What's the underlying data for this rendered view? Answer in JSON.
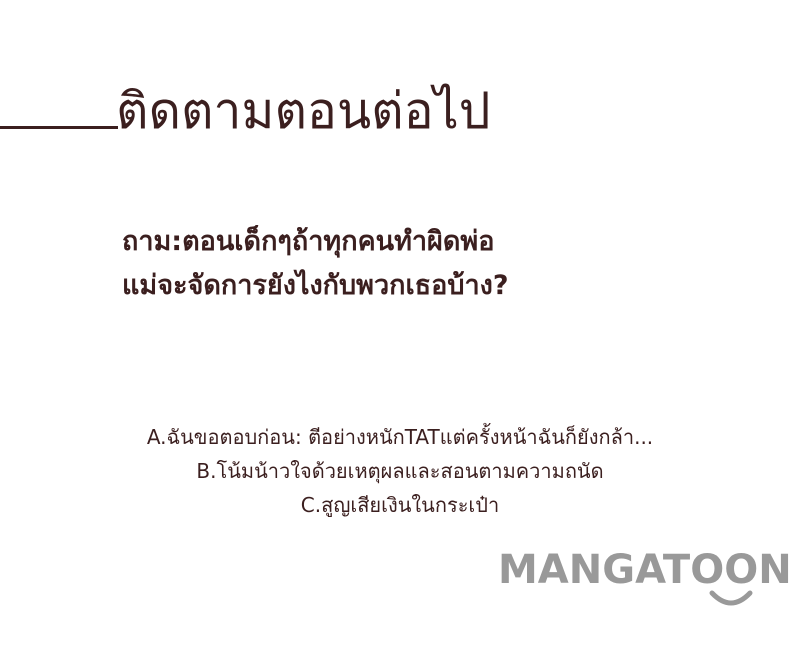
{
  "heading": "ติดตามตอนต่อไป",
  "question": {
    "line1": "ถาม:ตอนเด็กๆถ้าทุกคนทำผิดพ่อ",
    "line2": "แม่จะจัดการยังไงกับพวกเธอบ้าง?"
  },
  "options": [
    "A.ฉันขอตอบก่อน: ตีอย่างหนักTATแต่ครั้งหน้าฉันก็ยังกล้า...",
    "B.โน้มน้าวใจด้วยเหตุผลและสอนตามความถนัด",
    "C.สูญเสียเงินในกระเป๋า"
  ],
  "logo": {
    "text": "MANGATOON",
    "icon": "smile-icon",
    "color": "#999999"
  },
  "colors": {
    "text": "#3b1f1f",
    "background": "#ffffff"
  }
}
